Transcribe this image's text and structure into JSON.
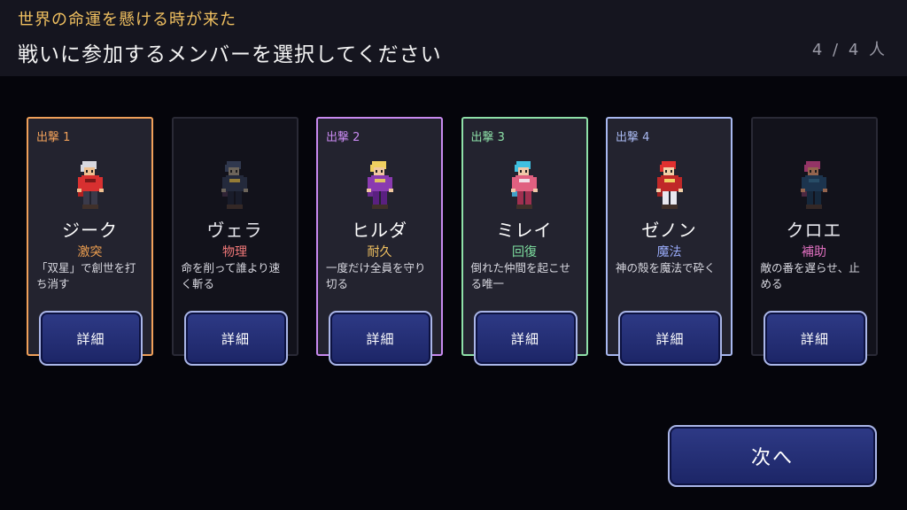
{
  "header": {
    "subtitle": "世界の命運を懸ける時が来た",
    "title": "戦いに参加するメンバーを選択してください",
    "count": "4 / 4 人"
  },
  "cards": [
    {
      "badge": "出撃 1",
      "name": "ジーク",
      "role": "激突",
      "desc": "「双星」で創世を打ち消す",
      "detail": "詳細",
      "selected": true,
      "accent": "#f0a05a",
      "role_color": "#f0a050",
      "sprite": "red-warrior-sprite"
    },
    {
      "badge": "",
      "name": "ヴェラ",
      "role": "物理",
      "desc": "命を削って誰より速く斬る",
      "detail": "詳細",
      "selected": false,
      "accent": "#2a2a36",
      "role_color": "#f07878",
      "sprite": "dark-knight-sprite"
    },
    {
      "badge": "出撃 2",
      "name": "ヒルダ",
      "role": "耐久",
      "desc": "一度だけ全員を守り切る",
      "detail": "詳細",
      "selected": true,
      "accent": "#c88af0",
      "role_color": "#f0c060",
      "sprite": "purple-knight-sprite"
    },
    {
      "badge": "出撃 3",
      "name": "ミレイ",
      "role": "回復",
      "desc": "倒れた仲間を起こせる唯一",
      "detail": "詳細",
      "selected": true,
      "accent": "#8ee0a8",
      "role_color": "#7ee0a0",
      "sprite": "cyan-healer-sprite"
    },
    {
      "badge": "出撃 4",
      "name": "ゼノン",
      "role": "魔法",
      "desc": "神の殻を魔法で砕く",
      "detail": "詳細",
      "selected": true,
      "accent": "#a8b8f0",
      "role_color": "#98aaf8",
      "sprite": "red-mage-sprite"
    },
    {
      "badge": "",
      "name": "クロエ",
      "role": "補助",
      "desc": "敵の番を遅らせ、止める",
      "detail": "詳細",
      "selected": false,
      "accent": "#2a2a36",
      "role_color": "#e070c0",
      "sprite": "support-mage-sprite"
    }
  ],
  "next_button": {
    "label": "次へ"
  }
}
